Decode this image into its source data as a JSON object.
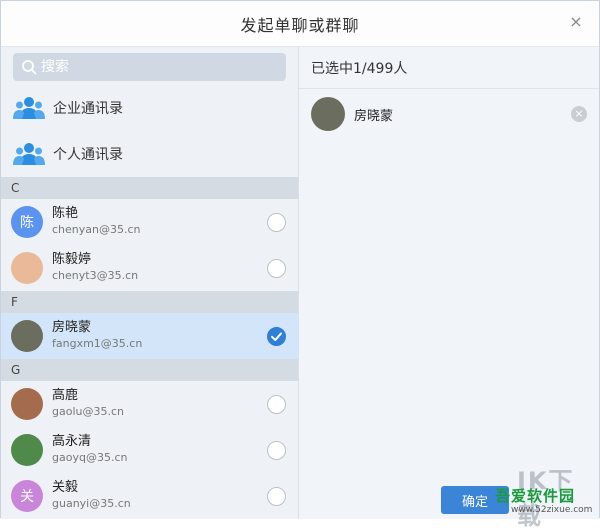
{
  "dialog": {
    "title": "发起单聊或群聊",
    "close_glyph": "×"
  },
  "search": {
    "placeholder": "搜索",
    "icon": "search-icon"
  },
  "directories": [
    {
      "label": "企业通讯录",
      "icon": "group-people-icon"
    },
    {
      "label": "个人通讯录",
      "icon": "group-people-icon"
    }
  ],
  "groups": [
    {
      "letter": "C",
      "contacts": [
        {
          "name": "陈艳",
          "email": "chenyan@35.cn",
          "avatar_text": "陈",
          "avatar_color": "#5b93f0",
          "selected": false
        },
        {
          "name": "陈毅婷",
          "email": "chenyt3@35.cn",
          "avatar_text": "",
          "avatar_color": "#e9b99a",
          "selected": false
        }
      ]
    },
    {
      "letter": "F",
      "contacts": [
        {
          "name": "房晓蒙",
          "email": "fangxm1@35.cn",
          "avatar_text": "",
          "avatar_color": "#6b6d5e",
          "selected": true
        }
      ]
    },
    {
      "letter": "G",
      "contacts": [
        {
          "name": "高鹿",
          "email": "gaolu@35.cn",
          "avatar_text": "",
          "avatar_color": "#a56b4f",
          "selected": false
        },
        {
          "name": "高永清",
          "email": "gaoyq@35.cn",
          "avatar_text": "",
          "avatar_color": "#4f8a4a",
          "selected": false
        },
        {
          "name": "关毅",
          "email": "guanyi@35.cn",
          "avatar_text": "关",
          "avatar_color": "#c986d8",
          "selected": false
        }
      ]
    }
  ],
  "right_panel": {
    "count_text": "已选中1/499人",
    "selected": [
      {
        "name": "房晓蒙",
        "avatar_color": "#6b6d5e",
        "remove_glyph": "×"
      }
    ]
  },
  "buttons": {
    "confirm_label": "确定"
  },
  "watermark": {
    "big": "IK下载",
    "main": "吾爱软件园",
    "sub": "www.52zixue.com"
  },
  "colors": {
    "accent": "#2f7fd6",
    "selected_row": "#d3e5f8",
    "group_header": "#d4dbe3"
  }
}
